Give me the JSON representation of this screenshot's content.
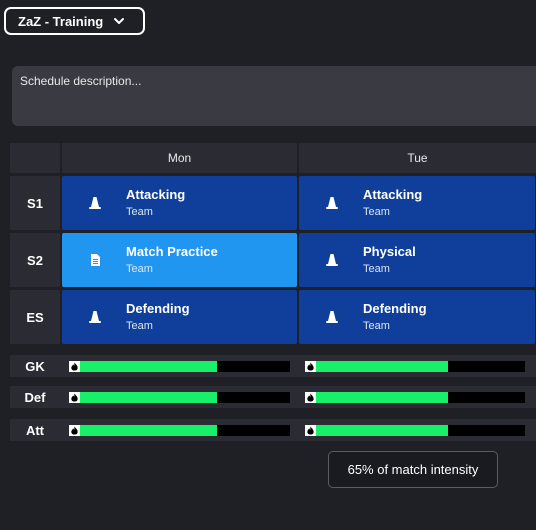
{
  "header": {
    "schedule_name": "ZaZ - Training"
  },
  "description": {
    "placeholder": "Schedule description..."
  },
  "days": [
    "Mon",
    "Tue"
  ],
  "sessions": {
    "labels": [
      "S1",
      "S2",
      "ES"
    ],
    "grid": [
      [
        {
          "title": "Attacking",
          "subtitle": "Team",
          "icon": "training-cone-icon",
          "highlight": false
        },
        {
          "title": "Attacking",
          "subtitle": "Team",
          "icon": "training-cone-icon",
          "highlight": false
        }
      ],
      [
        {
          "title": "Match Practice",
          "subtitle": "Team",
          "icon": "document-icon",
          "highlight": true
        },
        {
          "title": "Physical",
          "subtitle": "Team",
          "icon": "training-cone-icon",
          "highlight": false
        }
      ],
      [
        {
          "title": "Defending",
          "subtitle": "Team",
          "icon": "training-cone-icon",
          "highlight": false
        },
        {
          "title": "Defending",
          "subtitle": "Team",
          "icon": "training-cone-icon",
          "highlight": false
        }
      ]
    ]
  },
  "intensity": {
    "rows": [
      {
        "label": "GK",
        "levels": [
          0.67,
          0.65
        ]
      },
      {
        "label": "Def",
        "levels": [
          0.67,
          0.65
        ]
      },
      {
        "label": "Att",
        "levels": [
          0.67,
          0.65
        ]
      }
    ],
    "icon": "fire-icon"
  },
  "tooltip": {
    "text": "65% of match intensity"
  },
  "colors": {
    "session": "#0f3f9a",
    "session_highlight": "#2196f0",
    "intensity_fill": "#19f06a"
  }
}
